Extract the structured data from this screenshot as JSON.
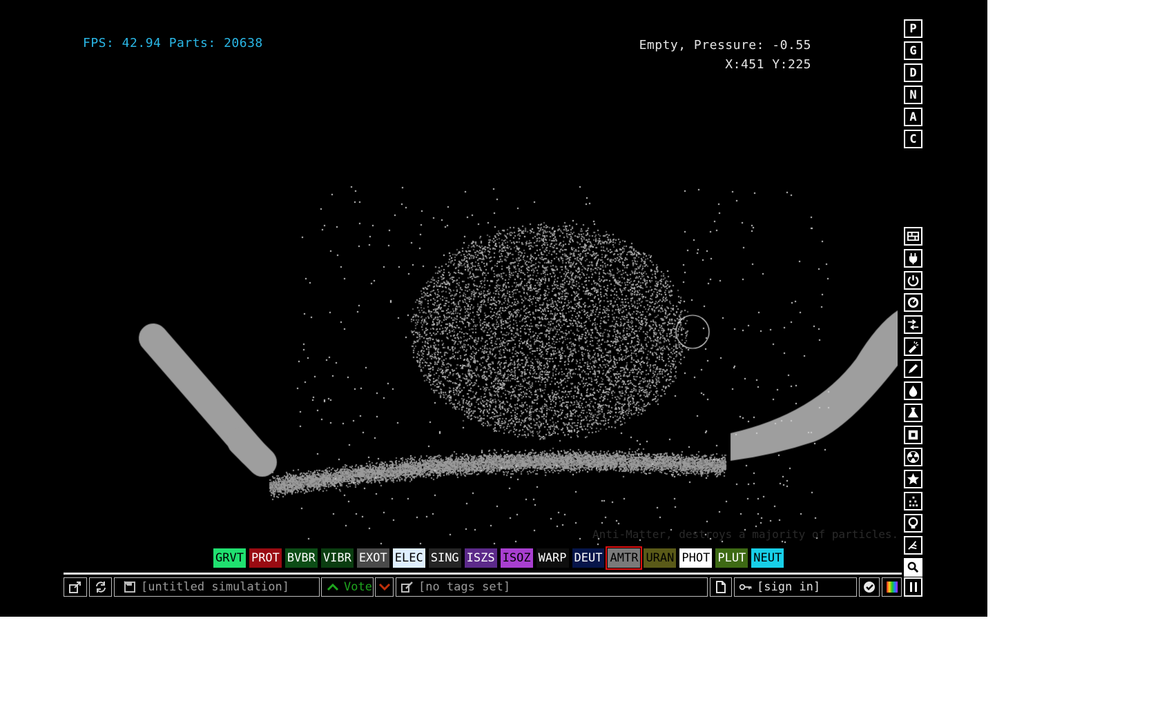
{
  "hud": {
    "fps_text": "FPS: 42.94 Parts: 20638",
    "pressure_text": "Empty, Pressure: -0.55",
    "coords_text": "X:451 Y:225"
  },
  "tooltip": "Anti-Matter, destroys a majority of particles.",
  "display_modes": [
    "P",
    "G",
    "D",
    "N",
    "A",
    "C"
  ],
  "categories": [
    {
      "name": "walls-category",
      "icon": "wall-grid-icon"
    },
    {
      "name": "electronics-category",
      "icon": "plug-icon"
    },
    {
      "name": "powered-category",
      "icon": "power-icon"
    },
    {
      "name": "sensors-category",
      "icon": "gauge-icon"
    },
    {
      "name": "force-category",
      "icon": "arrows-icon"
    },
    {
      "name": "explosives-category",
      "icon": "explosive-icon"
    },
    {
      "name": "gases-category",
      "icon": "pen-icon"
    },
    {
      "name": "liquids-category",
      "icon": "drop-icon"
    },
    {
      "name": "powders-category",
      "icon": "flask-icon"
    },
    {
      "name": "solids-category",
      "icon": "square-icon"
    },
    {
      "name": "radioactive-category",
      "icon": "radiation-icon"
    },
    {
      "name": "special-category",
      "icon": "star-icon"
    },
    {
      "name": "life-category",
      "icon": "dots-icon"
    },
    {
      "name": "tools-category",
      "icon": "bulb-icon"
    },
    {
      "name": "recent-category",
      "icon": "hand-icon"
    },
    {
      "name": "search-category",
      "icon": "search-icon"
    }
  ],
  "elements": [
    {
      "label": "GRVT",
      "bg": "#20e070",
      "fg": "#000000"
    },
    {
      "label": "PROT",
      "bg": "#9a0b12",
      "fg": "#ffffff"
    },
    {
      "label": "BVBR",
      "bg": "#0c4d16",
      "fg": "#ffffff"
    },
    {
      "label": "VIBR",
      "bg": "#0a3d10",
      "fg": "#ffffff"
    },
    {
      "label": "EXOT",
      "bg": "#4a4a4a",
      "fg": "#ffffff"
    },
    {
      "label": "ELEC",
      "bg": "#dfefff",
      "fg": "#000000"
    },
    {
      "label": "SING",
      "bg": "#252525",
      "fg": "#ffffff"
    },
    {
      "label": "ISZS",
      "bg": "#5c2a8a",
      "fg": "#ffffff"
    },
    {
      "label": "ISOZ",
      "bg": "#a83fd0",
      "fg": "#000000"
    },
    {
      "label": "WARP",
      "bg": "#0e0e0e",
      "fg": "#ffffff"
    },
    {
      "label": "DEUT",
      "bg": "#06154a",
      "fg": "#ffffff"
    },
    {
      "label": "AMTR",
      "bg": "#7a7a7a",
      "fg": "#000000",
      "selected": true
    },
    {
      "label": "URAN",
      "bg": "#5a5a18",
      "fg": "#000000"
    },
    {
      "label": "PHOT",
      "bg": "#ffffff",
      "fg": "#000000"
    },
    {
      "label": "PLUT",
      "bg": "#3e6a14",
      "fg": "#ffffff"
    },
    {
      "label": "NEUT",
      "bg": "#18cfe8",
      "fg": "#000000"
    }
  ],
  "bottom_bar": {
    "save_title": "[untitled simulation]",
    "vote_label": "Vote",
    "tags": "[no tags set]",
    "sign_in": "[sign in]"
  },
  "colors": {
    "background": "#000000",
    "hud_fps": "#2ab7e6",
    "walls": "#9e9e9e",
    "vote_green": "#1ea51e",
    "vote_down_red": "#c0300a"
  }
}
